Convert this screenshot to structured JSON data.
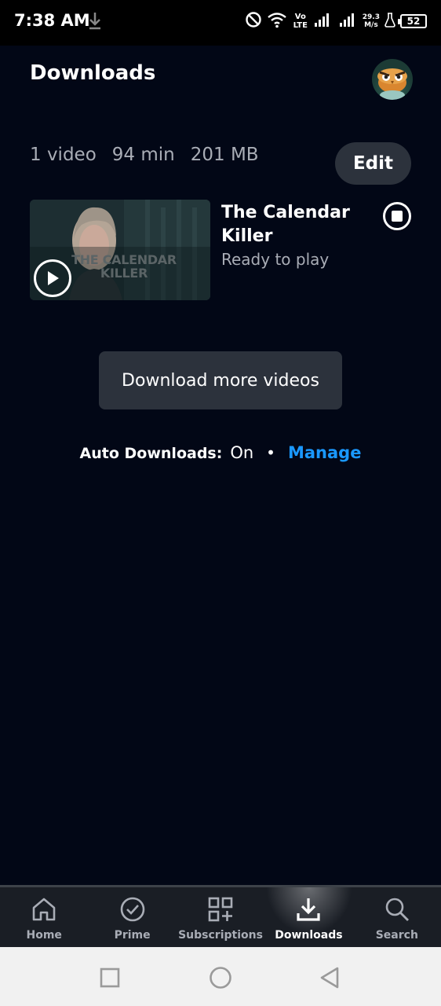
{
  "status_bar": {
    "time": "7:38 AM",
    "net_speed_value": "29.3",
    "net_speed_unit": "M/s",
    "network": "Vo LTE",
    "battery": "52"
  },
  "header": {
    "title": "Downloads"
  },
  "summary": {
    "count": "1 video",
    "duration": "94 min",
    "size": "201 MB"
  },
  "toolbar": {
    "edit_label": "Edit"
  },
  "videos": [
    {
      "title": "The Calendar Killer",
      "status": "Ready to play",
      "thumbnail_text": "THE CALENDAR KILLER"
    }
  ],
  "download_more_label": "Download more videos",
  "auto_downloads": {
    "label": "Auto Downloads:",
    "state": "On",
    "separator": "•",
    "manage_label": "Manage"
  },
  "bottom_nav": {
    "items": [
      {
        "label": "Home",
        "icon": "home-icon"
      },
      {
        "label": "Prime",
        "icon": "checkmark-circle-icon"
      },
      {
        "label": "Subscriptions",
        "icon": "grid-plus-icon"
      },
      {
        "label": "Downloads",
        "icon": "download-icon"
      },
      {
        "label": "Search",
        "icon": "search-icon"
      }
    ],
    "active": "Downloads"
  },
  "colors": {
    "background": "#020716",
    "accent": "#1a98ff",
    "button_bg": "#2c323c",
    "secondary_text": "#a9adb6"
  }
}
